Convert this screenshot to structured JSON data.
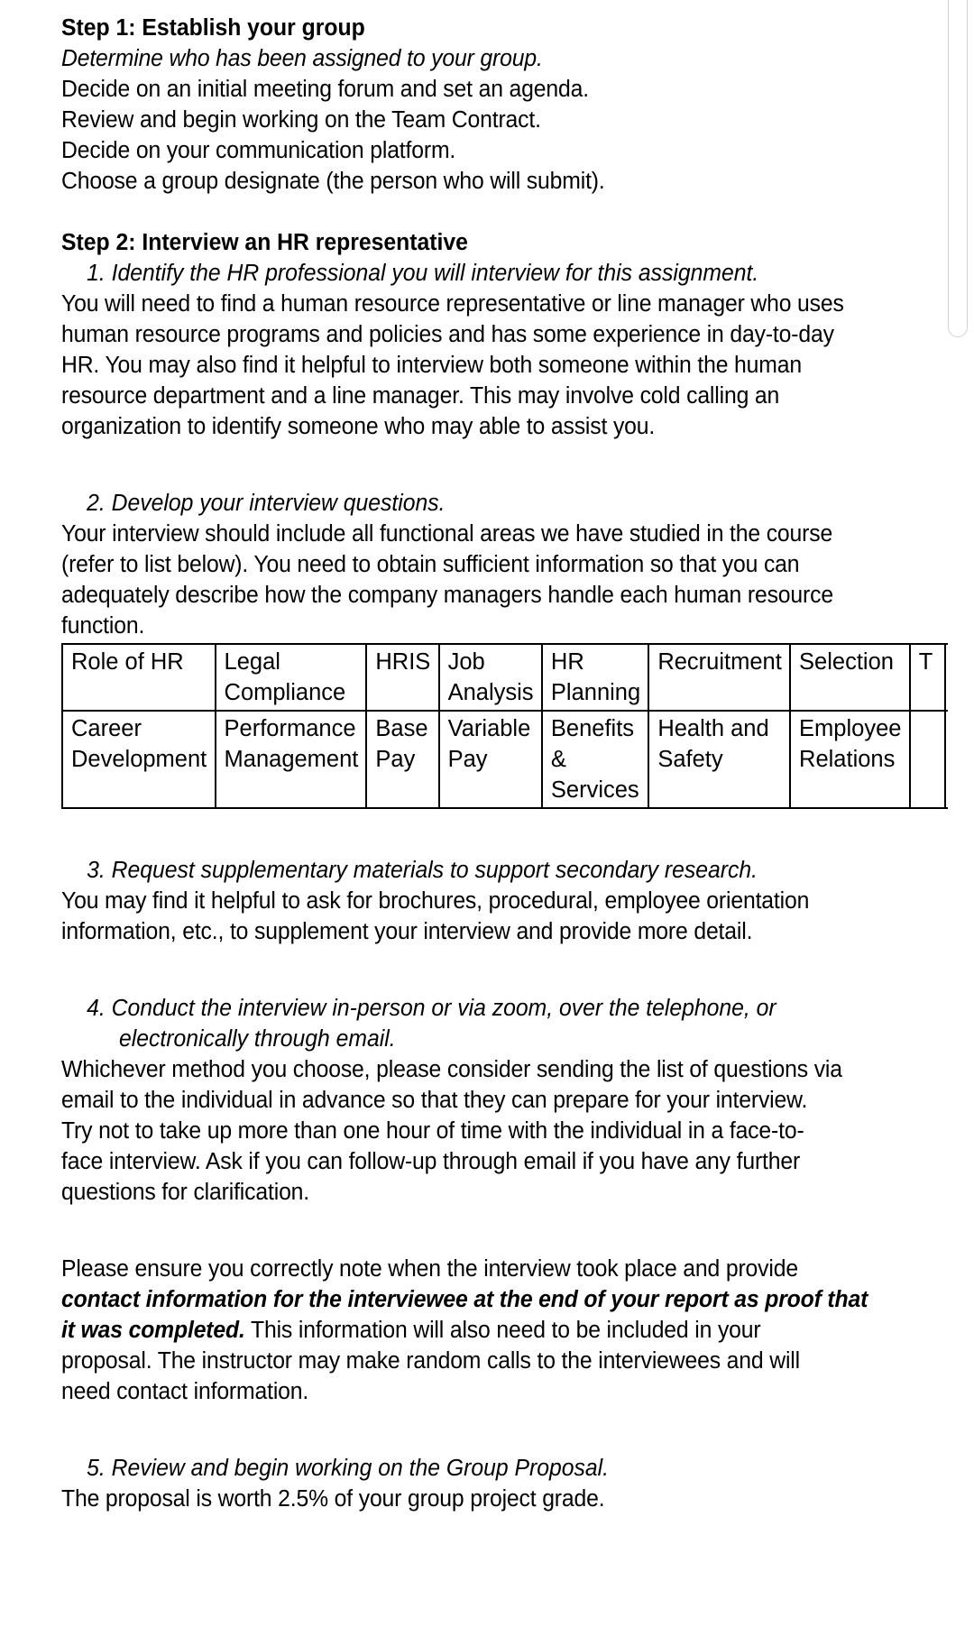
{
  "document": {
    "step1": {
      "heading": "Step 1: Establish your group",
      "lines": [
        "Determine who has been assigned to your group.",
        "Decide on an initial meeting forum and set an agenda.",
        "Review and begin working on the Team Contract.",
        "Decide on your communication platform.",
        "Choose a group designate (the person who will submit)."
      ]
    },
    "step2": {
      "heading": "Step 2: Interview an HR representative",
      "item1": {
        "number": "1.",
        "title": "Identify the HR professional you will interview for this assignment.",
        "body_lines": [
          "You will need to find a human resource representative or line manager who uses",
          "human resource programs and policies and has some experience in day-to-day",
          "HR. You may also find it helpful to interview both someone within the human",
          "resource department and a line manager. This may involve cold calling an",
          "organization to identify someone who may able to assist you."
        ]
      },
      "item2": {
        "number": "2.",
        "title": "Develop your interview questions.",
        "body_lines": [
          "Your interview should include all functional areas we have studied in the course",
          "(refer to list below). You need to obtain sufficient information so that you can",
          "adequately describe how the company managers handle each human resource",
          "function."
        ]
      },
      "item3": {
        "number": "3.",
        "title": "Request supplementary materials to support secondary research.",
        "body_lines": [
          "You may find it helpful to ask for brochures, procedural, employee orientation",
          "information, etc., to supplement your interview and provide more detail."
        ]
      },
      "item4": {
        "number": "4.",
        "title_line1": "Conduct the interview in-person or via zoom, over the telephone, or",
        "title_line2": "electronically through email.",
        "body_lines": [
          "Whichever method you choose, please consider sending the list of questions via",
          "email to the individual in advance so that they can prepare for your interview.",
          "Try not to take up more than one hour of time with the individual in a face-to-",
          "face interview. Ask if you can follow-up through email if you have any further",
          "questions for clarification."
        ]
      },
      "note": {
        "line1_plain": "Please ensure you correctly note when the interview took place and provide",
        "line2_bold": "contact information for the interviewee at the end of your report as proof that",
        "line3_bold": "it was completed.",
        "line3_plain": " This information will also need to be included in your",
        "line4_plain": "proposal. The instructor may make random calls to the interviewees and will",
        "line5_plain": "need contact information."
      },
      "item5": {
        "number": "5.",
        "title": "Review and begin working on the Group Proposal.",
        "body_lines": [
          "The proposal is worth 2.5% of your group project grade."
        ]
      }
    },
    "hr_functions_table": {
      "rows": [
        [
          "Role of HR",
          "Legal Compliance",
          "HRIS",
          "Job Analysis",
          "HR Planning",
          "Recruitment",
          "Selection",
          "T",
          ""
        ],
        [
          "Career Development",
          "Performance Management",
          "Base Pay",
          "Variable Pay",
          "Benefits & Services",
          "Health and Safety",
          "Employee Relations",
          "",
          ""
        ]
      ]
    }
  },
  "scrollbar": {
    "orientation": "vertical"
  }
}
